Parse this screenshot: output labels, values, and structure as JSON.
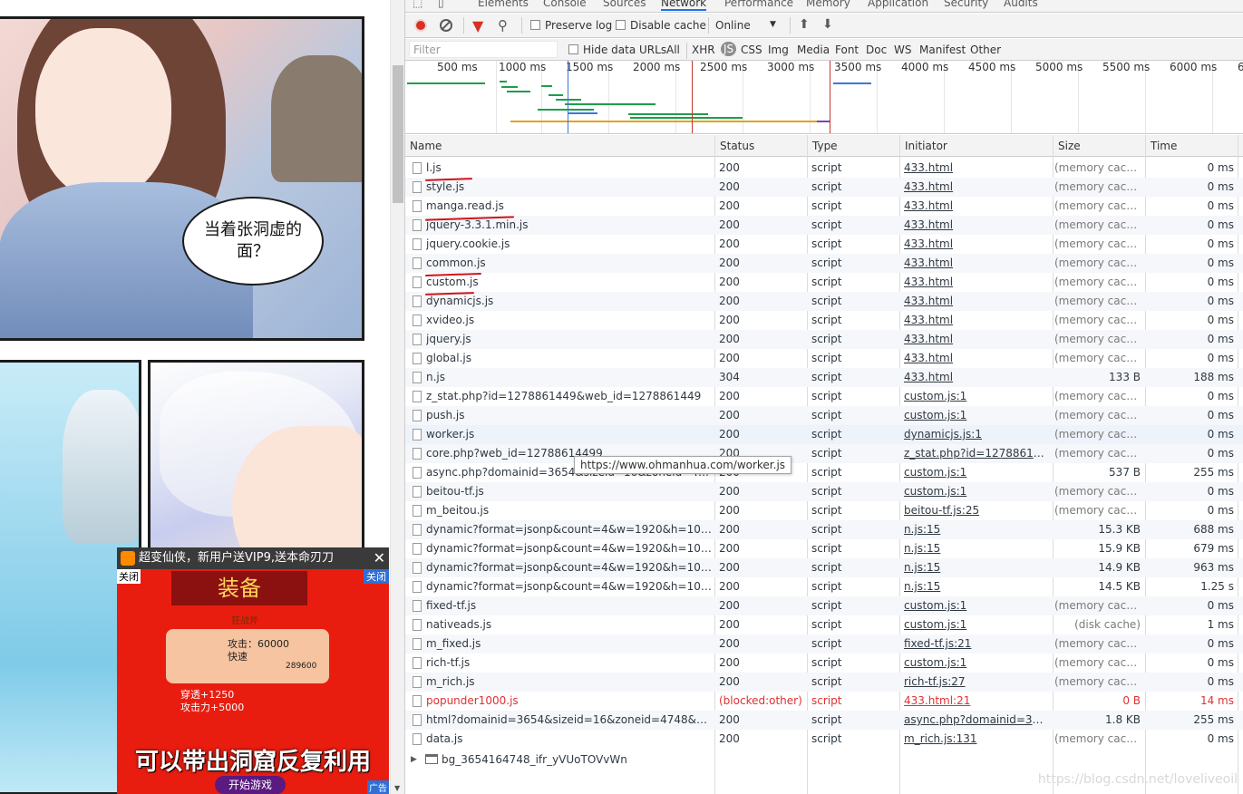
{
  "manga": {
    "speech_bubble": "当着张洞虚的面？"
  },
  "ad": {
    "title": "超变仙侠，新用户送VIP9,送本命刃刀",
    "close_x": "✕",
    "close_left": "关闭",
    "close_right": "关闭",
    "banner": "装备",
    "subtitle": "狂战斧",
    "stat_attack": "攻击：60000",
    "stat_speed": "快速",
    "stat_power": "289600",
    "bonus1": "穿透+1250",
    "bonus2": "攻击力+5000",
    "caption": "可以带出洞窟反复利用",
    "start_button": "开始游戏",
    "tag": "广告"
  },
  "devtools": {
    "tabs": [
      "Elements",
      "Console",
      "Sources",
      "Network",
      "Performance",
      "Memory",
      "Application",
      "Security",
      "Audits"
    ],
    "toolbar": {
      "preserve_log": "Preserve log",
      "disable_cache": "Disable cache",
      "throttling": "Online"
    },
    "filterbar": {
      "placeholder": "Filter",
      "hide_data_urls": "Hide data URLs",
      "types": [
        "All",
        "XHR",
        "JS",
        "CSS",
        "Img",
        "Media",
        "Font",
        "Doc",
        "WS",
        "Manifest",
        "Other"
      ]
    },
    "overview_ticks": [
      "500 ms",
      "1000 ms",
      "1500 ms",
      "2000 ms",
      "2500 ms",
      "3000 ms",
      "3500 ms",
      "4000 ms",
      "4500 ms",
      "5000 ms",
      "5500 ms",
      "6000 ms",
      "6"
    ],
    "columns": [
      "Name",
      "Status",
      "Type",
      "Initiator",
      "Size",
      "Time",
      "W"
    ],
    "rows": [
      {
        "name": "l.js",
        "status": "200",
        "type": "script",
        "initiator": "433.html",
        "size": "(memory cache)",
        "time": "0 ms"
      },
      {
        "name": "style.js",
        "status": "200",
        "type": "script",
        "initiator": "433.html",
        "size": "(memory cache)",
        "time": "0 ms"
      },
      {
        "name": "manga.read.js",
        "status": "200",
        "type": "script",
        "initiator": "433.html",
        "size": "(memory cache)",
        "time": "0 ms"
      },
      {
        "name": "jquery-3.3.1.min.js",
        "status": "200",
        "type": "script",
        "initiator": "433.html",
        "size": "(memory cache)",
        "time": "0 ms"
      },
      {
        "name": "jquery.cookie.js",
        "status": "200",
        "type": "script",
        "initiator": "433.html",
        "size": "(memory cache)",
        "time": "0 ms"
      },
      {
        "name": "common.js",
        "status": "200",
        "type": "script",
        "initiator": "433.html",
        "size": "(memory cache)",
        "time": "0 ms"
      },
      {
        "name": "custom.js",
        "status": "200",
        "type": "script",
        "initiator": "433.html",
        "size": "(memory cache)",
        "time": "0 ms"
      },
      {
        "name": "dynamicjs.js",
        "status": "200",
        "type": "script",
        "initiator": "433.html",
        "size": "(memory cache)",
        "time": "0 ms"
      },
      {
        "name": "xvideo.js",
        "status": "200",
        "type": "script",
        "initiator": "433.html",
        "size": "(memory cache)",
        "time": "0 ms"
      },
      {
        "name": "jquery.js",
        "status": "200",
        "type": "script",
        "initiator": "433.html",
        "size": "(memory cache)",
        "time": "0 ms"
      },
      {
        "name": "global.js",
        "status": "200",
        "type": "script",
        "initiator": "433.html",
        "size": "(memory cache)",
        "time": "0 ms"
      },
      {
        "name": "n.js",
        "status": "304",
        "type": "script",
        "initiator": "433.html",
        "size": "133 B",
        "time": "188 ms"
      },
      {
        "name": "z_stat.php?id=1278861449&web_id=1278861449",
        "status": "200",
        "type": "script",
        "initiator": "custom.js:1",
        "size": "(memory cache)",
        "time": "0 ms"
      },
      {
        "name": "push.js",
        "status": "200",
        "type": "script",
        "initiator": "custom.js:1",
        "size": "(memory cache)",
        "time": "0 ms"
      },
      {
        "name": "worker.js",
        "status": "200",
        "type": "script",
        "initiator": "dynamicjs.js:1",
        "size": "(memory cache)",
        "time": "0 ms"
      },
      {
        "name": "core.php?web_id=12788614499",
        "status": "200",
        "type": "script",
        "initiator": "z_stat.php?id=1278861449&...",
        "size": "(memory cache)",
        "time": "0 ms"
      },
      {
        "name": "async.php?domainid=3654&sizeid=16&zoneid=4748&k...",
        "status": "200",
        "type": "script",
        "initiator": "custom.js:1",
        "size": "537 B",
        "time": "255 ms"
      },
      {
        "name": "beitou-tf.js",
        "status": "200",
        "type": "script",
        "initiator": "custom.js:1",
        "size": "(memory cache)",
        "time": "0 ms"
      },
      {
        "name": "m_beitou.js",
        "status": "200",
        "type": "script",
        "initiator": "beitou-tf.js:25",
        "size": "(memory cache)",
        "time": "0 ms"
      },
      {
        "name": "dynamic?format=jsonp&count=4&w=1920&h=1080&ke...",
        "status": "200",
        "type": "script",
        "initiator": "n.js:15",
        "size": "15.3 KB",
        "time": "688 ms"
      },
      {
        "name": "dynamic?format=jsonp&count=4&w=1920&h=1080&ke...",
        "status": "200",
        "type": "script",
        "initiator": "n.js:15",
        "size": "15.9 KB",
        "time": "679 ms"
      },
      {
        "name": "dynamic?format=jsonp&count=4&w=1920&h=1080&ke...",
        "status": "200",
        "type": "script",
        "initiator": "n.js:15",
        "size": "14.9 KB",
        "time": "963 ms"
      },
      {
        "name": "dynamic?format=jsonp&count=4&w=1920&h=1080&ke...",
        "status": "200",
        "type": "script",
        "initiator": "n.js:15",
        "size": "14.5 KB",
        "time": "1.25 s"
      },
      {
        "name": "fixed-tf.js",
        "status": "200",
        "type": "script",
        "initiator": "custom.js:1",
        "size": "(memory cache)",
        "time": "0 ms"
      },
      {
        "name": "nativeads.js",
        "status": "200",
        "type": "script",
        "initiator": "custom.js:1",
        "size": "(disk cache)",
        "time": "1 ms"
      },
      {
        "name": "m_fixed.js",
        "status": "200",
        "type": "script",
        "initiator": "fixed-tf.js:21",
        "size": "(memory cache)",
        "time": "0 ms"
      },
      {
        "name": "rich-tf.js",
        "status": "200",
        "type": "script",
        "initiator": "custom.js:1",
        "size": "(memory cache)",
        "time": "0 ms"
      },
      {
        "name": "m_rich.js",
        "status": "200",
        "type": "script",
        "initiator": "rich-tf.js:27",
        "size": "(memory cache)",
        "time": "0 ms"
      },
      {
        "name": "popunder1000.js",
        "status": "(blocked:other)",
        "type": "script",
        "initiator": "433.html:21",
        "size": "0 B",
        "time": "14 ms",
        "blocked": true
      },
      {
        "name": "html?domainid=3654&sizeid=16&zoneid=4748&wu=htt...",
        "status": "200",
        "type": "script",
        "initiator": "async.php?domainid=3654...",
        "size": "1.8 KB",
        "time": "255 ms"
      },
      {
        "name": "data.js",
        "status": "200",
        "type": "script",
        "initiator": "m_rich.js:131",
        "size": "(memory cache)",
        "time": "0 ms"
      }
    ],
    "iframe_row": "bg_3654164748_ifr_yVUoTOVvWn",
    "tooltip": "https://www.ohmanhua.com/worker.js",
    "watermark": "https://blog.csdn.net/loveliveoil",
    "colors": {
      "record": "#d93025",
      "blocked": "#e03131",
      "underline_annotation": "#d0141a"
    }
  }
}
